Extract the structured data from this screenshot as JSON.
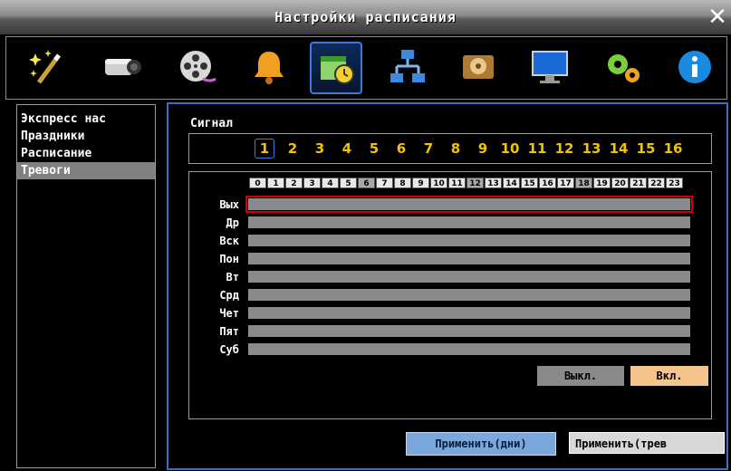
{
  "window": {
    "title": "Настройки расписания",
    "close_icon": "close-icon"
  },
  "toolbar": {
    "icons": [
      "magic-wand-icon",
      "camera-icon",
      "film-reel-icon",
      "bell-icon",
      "calendar-clock-icon",
      "network-icon",
      "hard-drive-icon",
      "monitor-icon",
      "gears-icon",
      "info-icon"
    ],
    "selected_index": 4,
    "colors": {
      "selected_border": "#3a7ad8"
    }
  },
  "sidebar": {
    "items": [
      {
        "label": "Экспресс нас",
        "selected": false
      },
      {
        "label": "Праздники",
        "selected": false
      },
      {
        "label": "Расписание",
        "selected": false
      },
      {
        "label": "Тревоги",
        "selected": true
      }
    ]
  },
  "signal": {
    "label": "Сигнал",
    "channels": [
      "1",
      "2",
      "3",
      "4",
      "5",
      "6",
      "7",
      "8",
      "9",
      "10",
      "11",
      "12",
      "13",
      "14",
      "15",
      "16"
    ],
    "selected_channel": "1",
    "channel_color": "#f2c400"
  },
  "schedule": {
    "hours": [
      "0",
      "1",
      "2",
      "3",
      "4",
      "5",
      "6",
      "7",
      "8",
      "9",
      "10",
      "11",
      "12",
      "13",
      "14",
      "15",
      "16",
      "17",
      "18",
      "19",
      "20",
      "21",
      "22",
      "23"
    ],
    "days": [
      {
        "label": "Вых",
        "selected": true
      },
      {
        "label": "Др",
        "selected": false
      },
      {
        "label": "Вск",
        "selected": false
      },
      {
        "label": "Пон",
        "selected": false
      },
      {
        "label": "Вт",
        "selected": false
      },
      {
        "label": "Срд",
        "selected": false
      },
      {
        "label": "Чет",
        "selected": false
      },
      {
        "label": "Пят",
        "selected": false
      },
      {
        "label": "Суб",
        "selected": false
      }
    ],
    "off_label": "Выкл.",
    "on_label": "Вкл.",
    "colors": {
      "bar": "#8a8a8a",
      "selected_outline": "#d00000",
      "on_button": "#f4c48c"
    }
  },
  "actions": {
    "apply_days": "Применить(дни)",
    "apply_alarms": "Применить(трев"
  }
}
